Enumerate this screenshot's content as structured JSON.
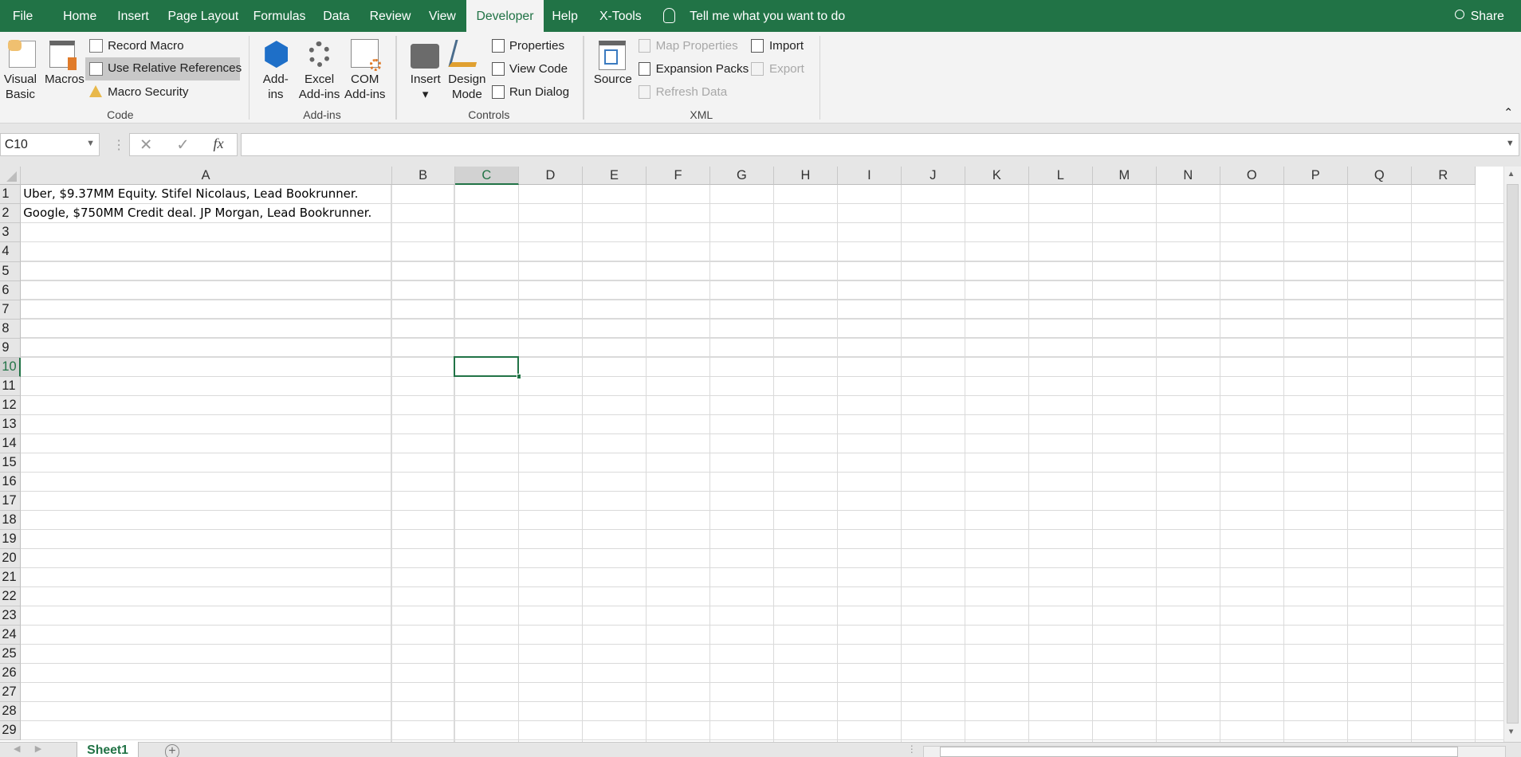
{
  "tabs": [
    "File",
    "Home",
    "Insert",
    "Page Layout",
    "Formulas",
    "Data",
    "Review",
    "View",
    "Developer",
    "Help",
    "X-Tools"
  ],
  "active_tab": "Developer",
  "tell_me": "Tell me what you want to do",
  "share": "Share",
  "ribbon": {
    "code": {
      "visual_basic": [
        "Visual",
        "Basic"
      ],
      "macros": "Macros",
      "record_macro": "Record Macro",
      "use_relative": "Use Relative References",
      "macro_security": "Macro Security",
      "label": "Code"
    },
    "addins": {
      "addins": [
        "Add-",
        "ins"
      ],
      "excel_addins": [
        "Excel",
        "Add-ins"
      ],
      "com_addins": [
        "COM",
        "Add-ins"
      ],
      "label": "Add-ins"
    },
    "controls": {
      "insert": "Insert",
      "design_mode": [
        "Design",
        "Mode"
      ],
      "properties": "Properties",
      "view_code": "View Code",
      "run_dialog": "Run Dialog",
      "label": "Controls"
    },
    "xml": {
      "source": "Source",
      "map_properties": "Map Properties",
      "expansion_packs": "Expansion Packs",
      "refresh_data": "Refresh Data",
      "import": "Import",
      "export": "Export",
      "label": "XML"
    }
  },
  "name_box": "C10",
  "formula": "",
  "fx": "fx",
  "columns": [
    "A",
    "B",
    "C",
    "D",
    "E",
    "F",
    "G",
    "H",
    "I",
    "J",
    "K",
    "L",
    "M",
    "N",
    "O",
    "P",
    "Q",
    "R"
  ],
  "selected_column": "C",
  "selected_row": 10,
  "row_count": 29,
  "cells": {
    "A1": "Uber, $9.37MM Equity. Stifel Nicolaus, Lead Bookrunner.",
    "A2": "Google, $750MM Credit deal. JP Morgan, Lead Bookrunner."
  },
  "sheets": [
    "Sheet1"
  ],
  "colors": {
    "accent": "#217346"
  }
}
